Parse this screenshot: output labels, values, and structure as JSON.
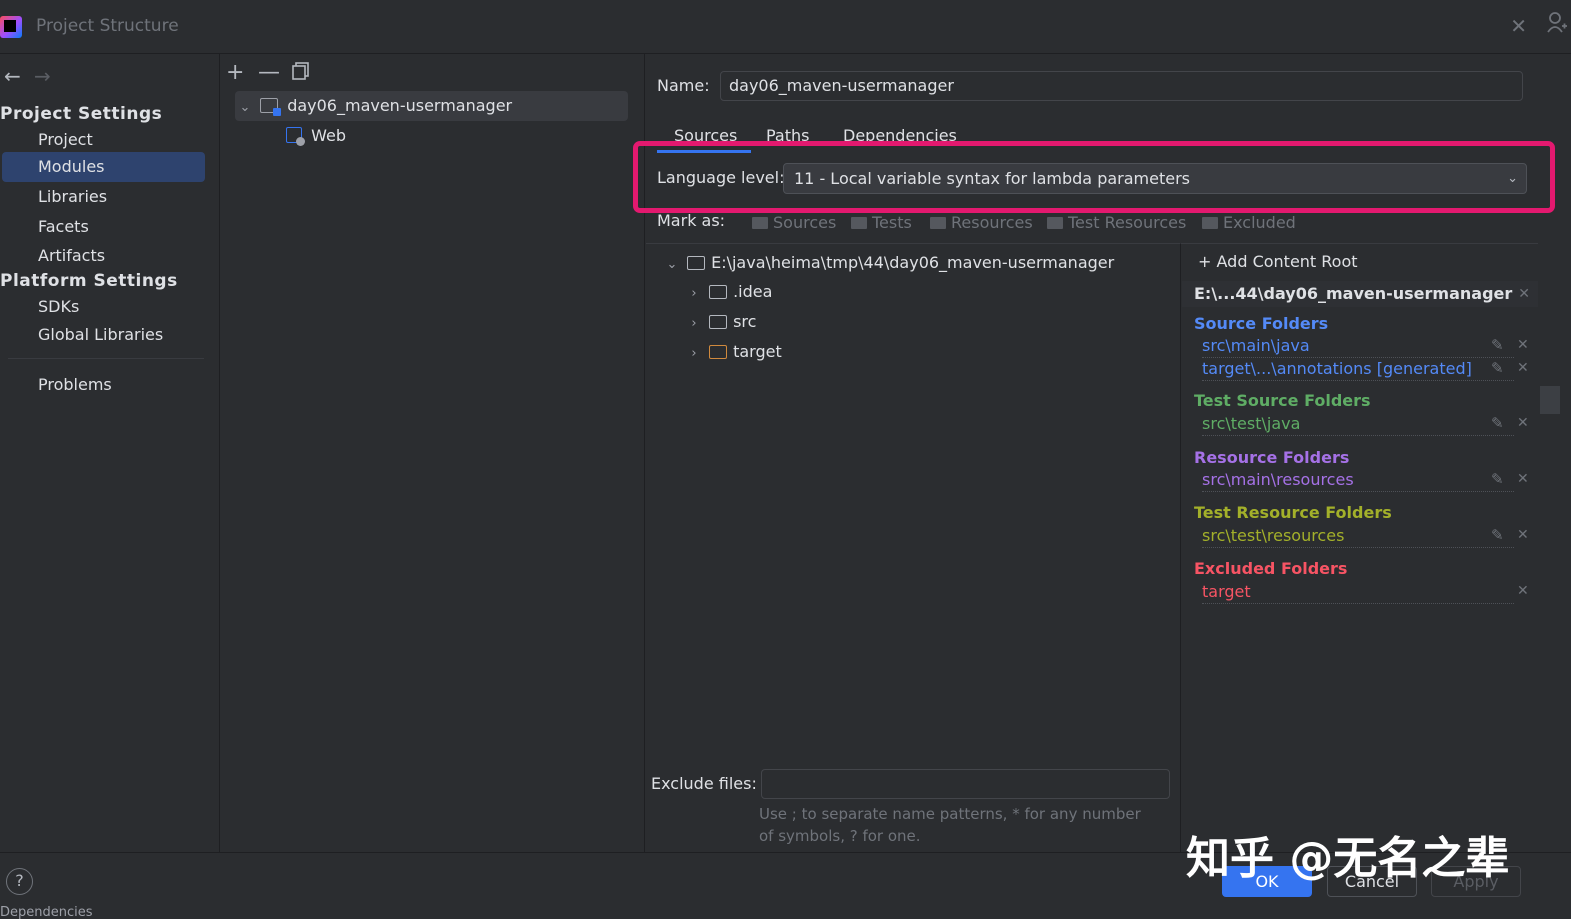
{
  "window": {
    "title": "Project Structure"
  },
  "sidebar": {
    "project_settings_header": "Project Settings",
    "platform_settings_header": "Platform Settings",
    "items": [
      {
        "label": "Project"
      },
      {
        "label": "Modules"
      },
      {
        "label": "Libraries"
      },
      {
        "label": "Facets"
      },
      {
        "label": "Artifacts"
      },
      {
        "label": "SDKs"
      },
      {
        "label": "Global Libraries"
      },
      {
        "label": "Problems"
      }
    ]
  },
  "module_tree": {
    "root": "day06_maven-usermanager",
    "child": "Web"
  },
  "details": {
    "name_label": "Name:",
    "name_value": "day06_maven-usermanager",
    "tabs": [
      "Sources",
      "Paths",
      "Dependencies"
    ],
    "language_level_label": "Language level:",
    "language_level_value": "11 - Local variable syntax for lambda parameters",
    "mark_as_label": "Mark as:",
    "mark_as": [
      "Sources",
      "Tests",
      "Resources",
      "Test Resources",
      "Excluded"
    ],
    "file_tree": {
      "root": "E:\\java\\heima\\tmp\\44\\day06_maven-usermanager",
      "children": [
        ".idea",
        "src",
        "target"
      ]
    },
    "exclude_files_label": "Exclude files:",
    "exclude_hint_line1": "Use ; to separate name patterns, * for any number",
    "exclude_hint_line2": "of symbols, ? for one."
  },
  "content_roots": {
    "add_label": "Add Content Root",
    "root_path": "E:\\...44\\day06_maven-usermanager",
    "groups": [
      {
        "title": "Source Folders",
        "color": "#548af7",
        "items": [
          "src\\main\\java",
          "target\\...\\annotations [generated]"
        ]
      },
      {
        "title": "Test Source Folders",
        "color": "#5fad65",
        "items": [
          "src\\test\\java"
        ]
      },
      {
        "title": "Resource Folders",
        "color": "#a571e6",
        "items": [
          "src\\main\\resources"
        ]
      },
      {
        "title": "Test Resource Folders",
        "color": "#a3b02a",
        "items": [
          "src\\test\\resources"
        ]
      },
      {
        "title": "Excluded Folders",
        "color": "#f75464",
        "items": [
          "target"
        ]
      }
    ]
  },
  "footer": {
    "help": "?",
    "status_fragment": "Dependencies",
    "ok": "OK",
    "cancel": "Cancel",
    "apply": "Apply",
    "watermark": "知乎 @无名之辈"
  },
  "colors": {
    "accent": "#3574f0",
    "highlight_box": "#e3196f",
    "selection": "#2e436e"
  }
}
